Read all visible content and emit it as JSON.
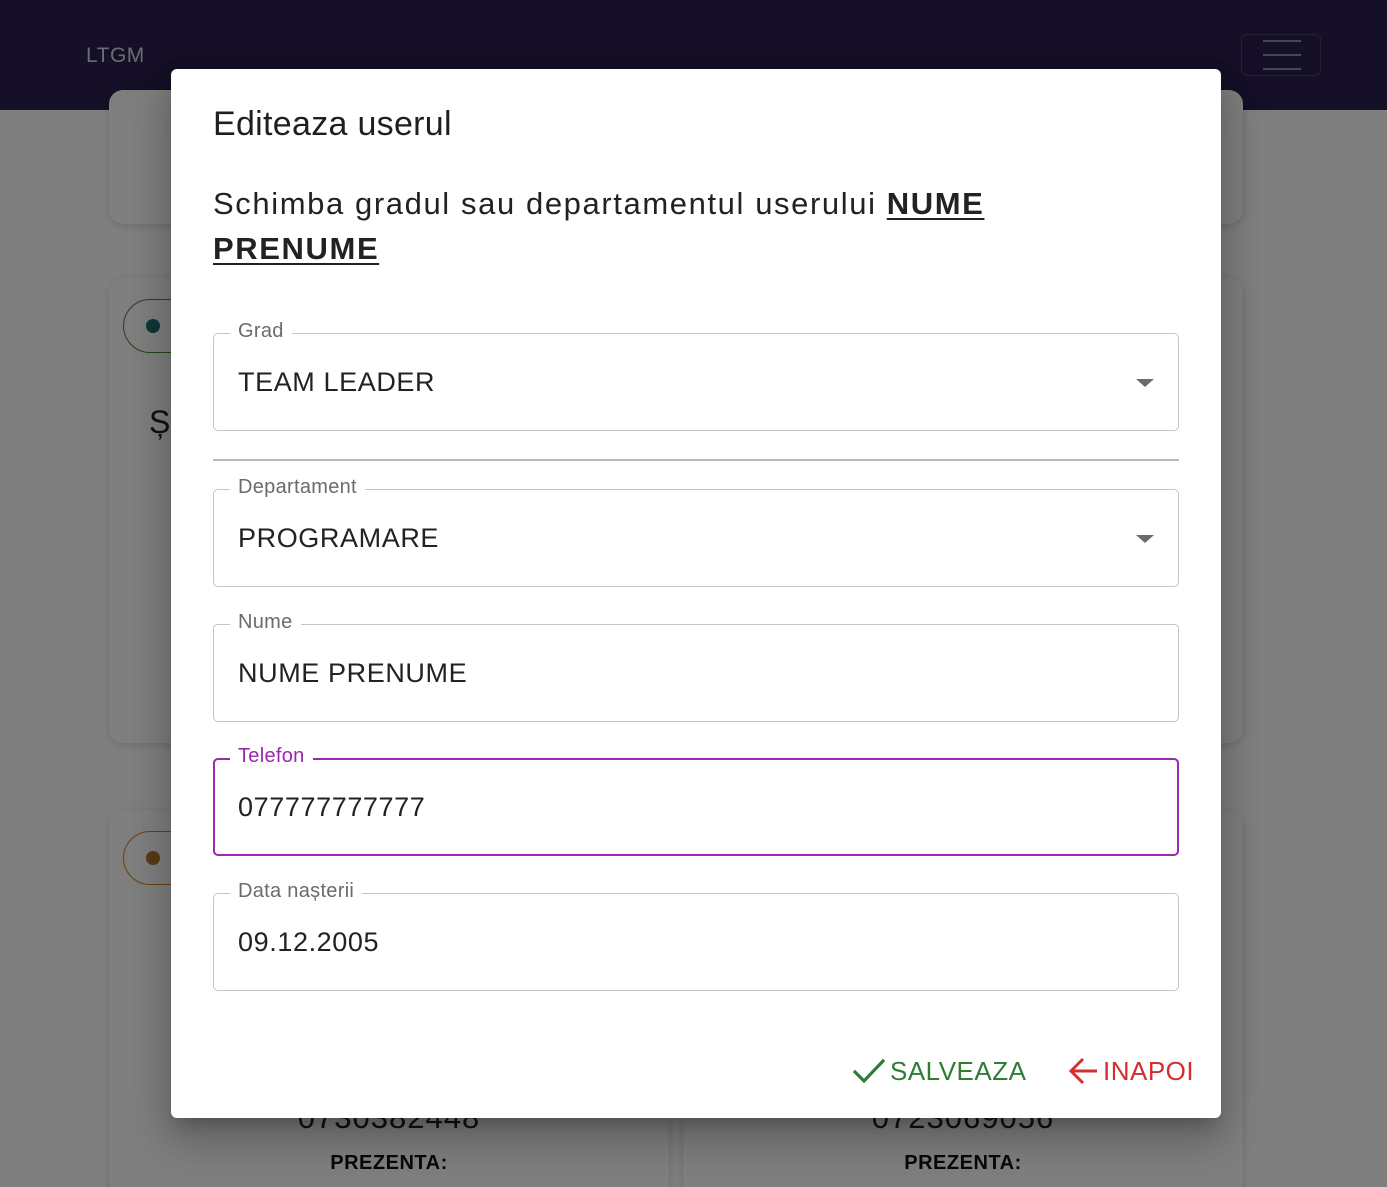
{
  "navbar": {
    "brand": "LTGM"
  },
  "background": {
    "cards": [
      {
        "phone": "0730382448",
        "label": "PREZENTA:"
      },
      {
        "phone": "0723069056",
        "label": "PREZENTA:"
      }
    ],
    "card_letter": "Ș"
  },
  "dialog": {
    "title": "Editeaza userul",
    "description": "Schimba gradul sau departamentul userului",
    "user_name": "NUME PRENUME",
    "fields": {
      "grad": {
        "label": "Grad",
        "value": "TEAM LEADER"
      },
      "departament": {
        "label": "Departament",
        "value": "PROGRAMARE"
      },
      "nume": {
        "label": "Nume",
        "value": "NUME PRENUME"
      },
      "telefon": {
        "label": "Telefon",
        "value": "077777777777"
      },
      "data_nasterii": {
        "label": "Data nașterii",
        "value": "09.12.2005"
      }
    },
    "actions": {
      "save_label": "SALVEAZA",
      "back_label": "INAPOI"
    }
  },
  "colors": {
    "navbar": "#2b1f4f",
    "focus_accent": "#9c27b0",
    "save": "#2e7d32",
    "back": "#d32f2f"
  },
  "icons": {
    "save": "check-icon",
    "back": "arrow-left-icon",
    "select": "caret-down-icon",
    "menu": "hamburger-menu-icon"
  }
}
